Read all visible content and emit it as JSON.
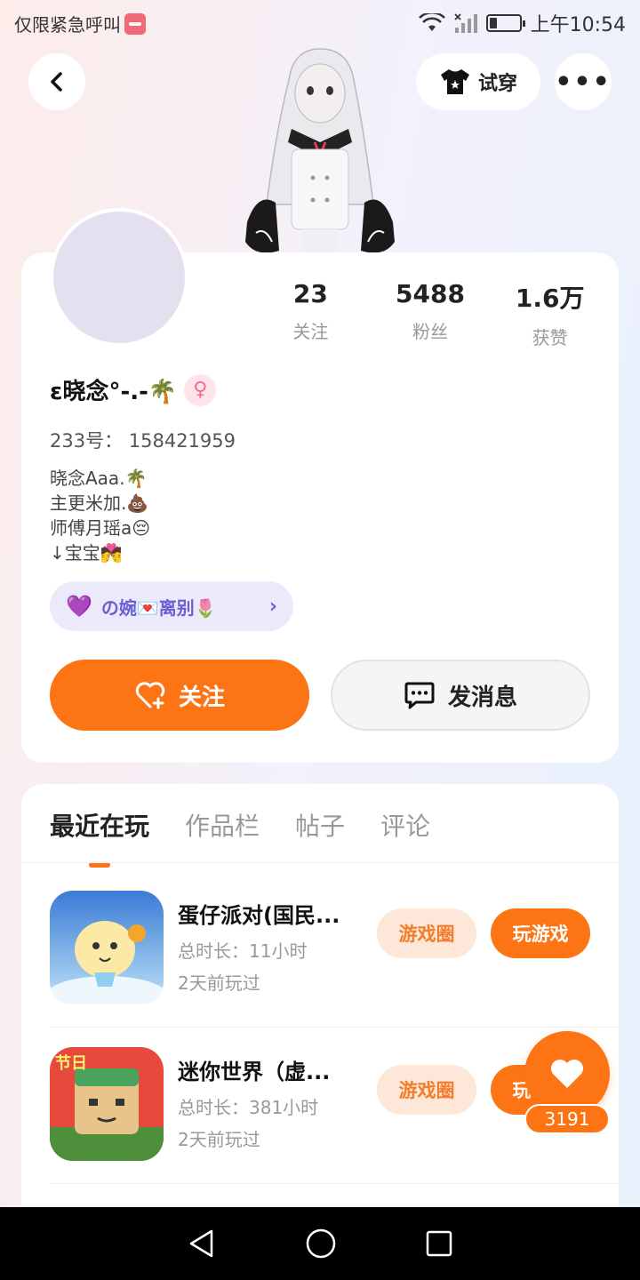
{
  "status_bar": {
    "left_text": "仅限紧急呼叫",
    "time": "上午10:54"
  },
  "header": {
    "try_on_label": "试穿",
    "more_label": "•••"
  },
  "profile": {
    "stats": [
      {
        "value": "23",
        "label": "关注"
      },
      {
        "value": "5488",
        "label": "粉丝"
      },
      {
        "value": "1.6万",
        "label": "获赞"
      }
    ],
    "username": "ε晓念°-.-🌴",
    "gender_symbol": "♀",
    "user_id": "233号： 158421959",
    "bio_lines": [
      "晓念Aaa.🌴",
      "主更米加.💩",
      "师傅月瑶a😔",
      "↓宝宝💏"
    ],
    "cp_tag": "の婉💌离别🌷",
    "follow_label": "关注",
    "message_label": "发消息"
  },
  "tabs": [
    "最近在玩",
    "作品栏",
    "帖子",
    "评论"
  ],
  "games": [
    {
      "title": "蛋仔派对(国民...",
      "duration": "总时长：11小时",
      "last_played": "2天前玩过",
      "circle_label": "游戏圈",
      "play_label": "玩游戏"
    },
    {
      "title": "迷你世界（虚...",
      "duration": "总时长：381小时",
      "last_played": "2天前玩过",
      "circle_label": "游戏圈",
      "play_label": "玩游戏"
    }
  ],
  "like_fab": {
    "count": "3191"
  },
  "colors": {
    "accent": "#fd7414",
    "cp_purple": "#6b5fd4",
    "tag_bg": "#fde7d9"
  }
}
